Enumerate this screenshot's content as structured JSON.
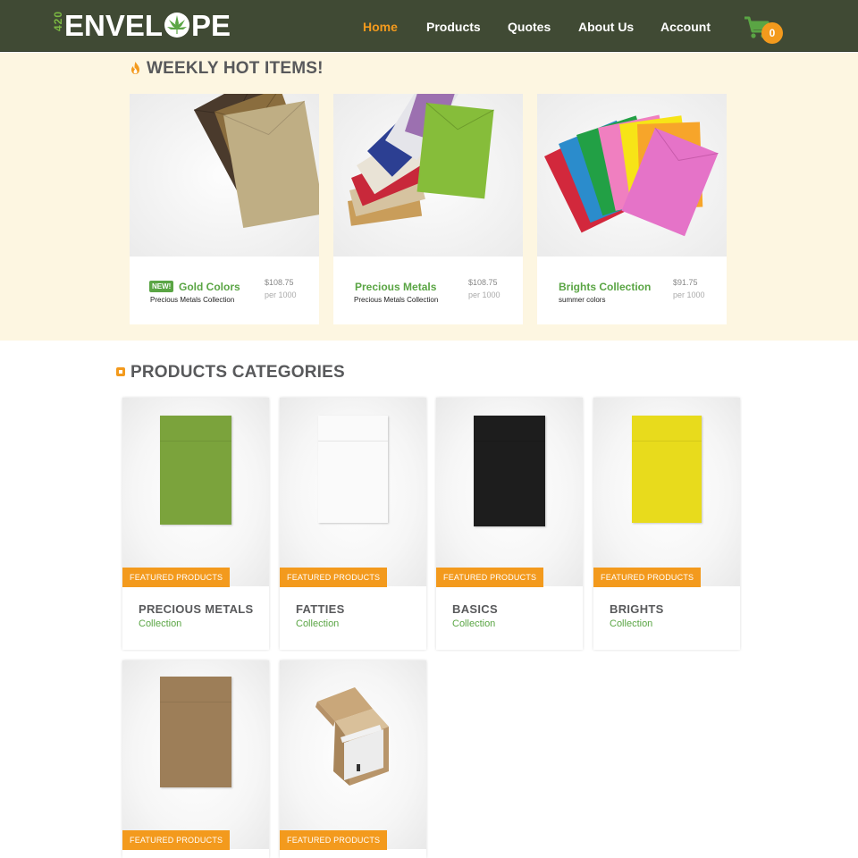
{
  "header": {
    "logo_prefix": "420",
    "logo_part1": "ENVEL",
    "logo_part2": "PE",
    "nav": [
      {
        "label": "Home",
        "active": true
      },
      {
        "label": "Products",
        "active": false
      },
      {
        "label": "Quotes",
        "active": false
      },
      {
        "label": "About Us",
        "active": false
      },
      {
        "label": "Account",
        "active": false
      }
    ],
    "cart_count": "0"
  },
  "hot_section": {
    "title": "WEEKLY HOT ITEMS!",
    "items": [
      {
        "badge": "NEW!",
        "name": "Gold Colors",
        "subtitle": "Precious Metals Collection",
        "price": "$108.75",
        "unit": "per 1000"
      },
      {
        "name": "Precious Metals",
        "subtitle": "Precious Metals Collection",
        "price": "$108.75",
        "unit": "per 1000"
      },
      {
        "name": "Brights Collection",
        "subtitle": "summer colors",
        "price": "$91.75",
        "unit": "per 1000"
      }
    ]
  },
  "categories": {
    "title": "PRODUCTS CATEGORIES",
    "items": [
      {
        "tag": "FEATURED PRODUCTS",
        "name": "PRECIOUS METALS",
        "collection": "Collection",
        "color": "#7ba33c"
      },
      {
        "tag": "FEATURED PRODUCTS",
        "name": "FATTIES",
        "collection": "Collection",
        "color": "#fafafa"
      },
      {
        "tag": "FEATURED PRODUCTS",
        "name": "BASICS",
        "collection": "Collection",
        "color": "#1d1d1d"
      },
      {
        "tag": "FEATURED PRODUCTS",
        "name": "BRIGHTS",
        "collection": "Collection",
        "color": "#e8db1c"
      },
      {
        "tag": "FEATURED PRODUCTS",
        "color": "#9d7e58"
      },
      {
        "tag": "FEATURED PRODUCTS"
      }
    ]
  },
  "colors": {
    "header_bg": "#404a34",
    "accent_orange": "#f39a1d",
    "accent_green": "#5aa544",
    "hot_bg": "#fdf6e1"
  }
}
